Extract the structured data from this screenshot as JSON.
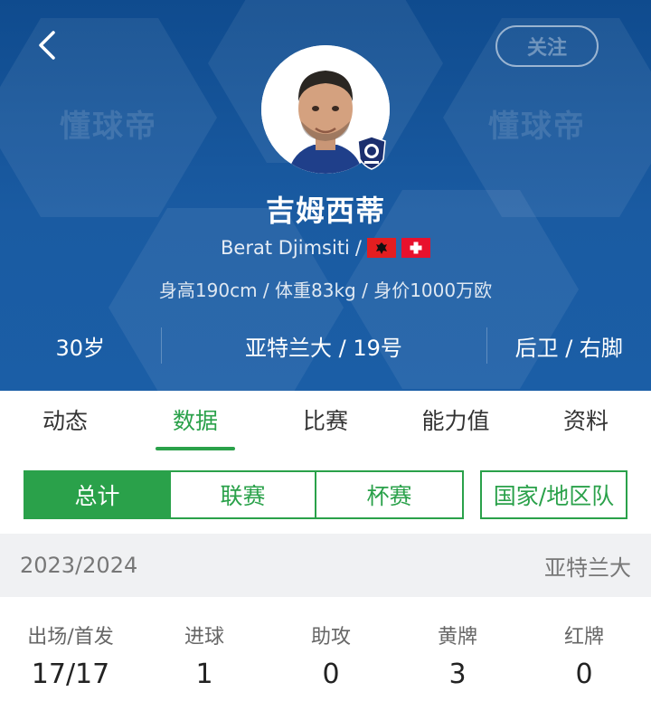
{
  "header": {
    "back_icon": "chevron-left-icon",
    "follow_label": "关注",
    "watermark_text": "懂球帝",
    "player_name": "吉姆西蒂",
    "english_name": "Berat Djimsiti",
    "english_name_sep": "/",
    "flags": [
      "albania-flag-icon",
      "switzerland-flag-icon"
    ],
    "physical": "身高190cm / 体重83kg / 身价1000万欧",
    "age": "30岁",
    "club_number": "亚特兰大 / 19号",
    "position_foot": "后卫 / 右脚"
  },
  "tabs": [
    {
      "label": "动态",
      "active": false
    },
    {
      "label": "数据",
      "active": true
    },
    {
      "label": "比赛",
      "active": false
    },
    {
      "label": "能力值",
      "active": false
    },
    {
      "label": "资料",
      "active": false
    }
  ],
  "segments": {
    "total": "总计",
    "league": "联赛",
    "cup": "杯赛",
    "national": "国家/地区队"
  },
  "season": {
    "years": "2023/2024",
    "team": "亚特兰大"
  },
  "stats": [
    {
      "label": "出场/首发",
      "value": "17/17"
    },
    {
      "label": "进球",
      "value": "1"
    },
    {
      "label": "助攻",
      "value": "0"
    },
    {
      "label": "黄牌",
      "value": "3"
    },
    {
      "label": "红牌",
      "value": "0"
    }
  ],
  "colors": {
    "header_blue": "#1a5ba2",
    "accent_green": "#2aa14a"
  }
}
